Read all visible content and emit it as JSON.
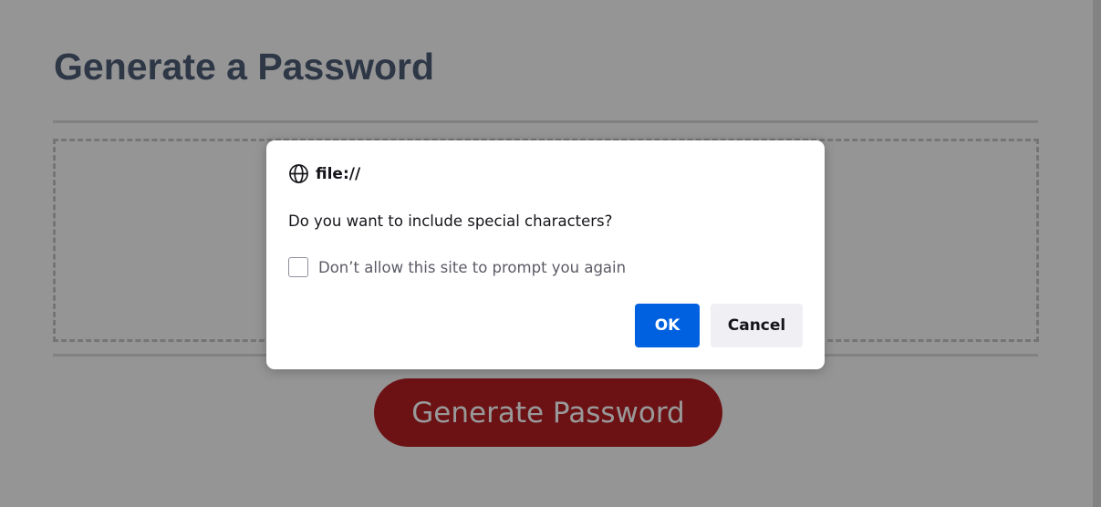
{
  "page": {
    "title": "Generate a Password",
    "generate_button_label": "Generate Password"
  },
  "dialog": {
    "origin": "file://",
    "origin_icon": "globe-icon",
    "message": "Do you want to include special characters?",
    "checkbox_label": "Don’t allow this site to prompt you again",
    "checkbox_checked": false,
    "ok_label": "OK",
    "cancel_label": "Cancel"
  },
  "colors": {
    "title": "#4e5c75",
    "generate_button_bg": "#b51e23",
    "ok_button_bg": "#0061e0",
    "cancel_button_bg": "#f0f0f4",
    "overlay": "rgba(0,0,0,0.40)"
  }
}
